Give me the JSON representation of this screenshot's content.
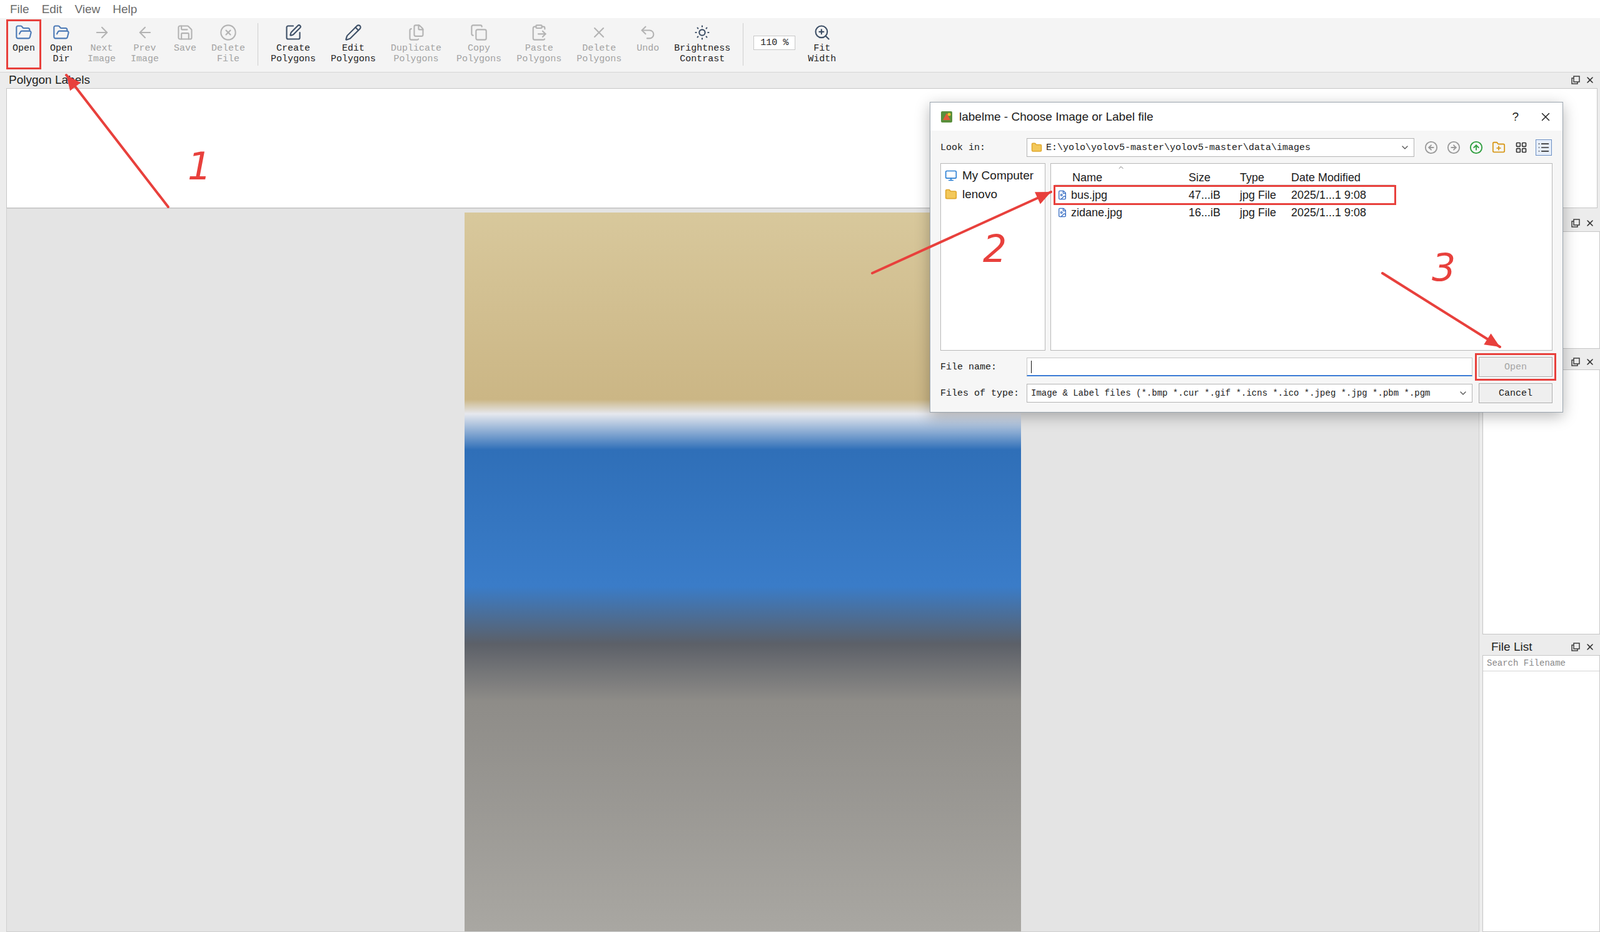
{
  "menu": [
    "File",
    "Edit",
    "View",
    "Help"
  ],
  "toolbar": [
    {
      "kind": "button",
      "label": "Open",
      "disabled": false,
      "highlighted": true
    },
    {
      "kind": "button",
      "label": "Open Dir",
      "disabled": false,
      "highlighted": false
    },
    {
      "kind": "button",
      "label": "Next Image",
      "disabled": true,
      "highlighted": false
    },
    {
      "kind": "button",
      "label": "Prev Image",
      "disabled": true,
      "highlighted": false
    },
    {
      "kind": "button",
      "label": "Save",
      "disabled": true,
      "highlighted": false
    },
    {
      "kind": "button",
      "label": "Delete File",
      "disabled": true,
      "highlighted": false
    },
    {
      "kind": "separator"
    },
    {
      "kind": "button",
      "label": "Create Polygons",
      "disabled": false,
      "highlighted": false
    },
    {
      "kind": "button",
      "label": "Edit Polygons",
      "disabled": false,
      "highlighted": false
    },
    {
      "kind": "button",
      "label": "Duplicate Polygons",
      "disabled": true,
      "highlighted": false
    },
    {
      "kind": "button",
      "label": "Copy Polygons",
      "disabled": true,
      "highlighted": false
    },
    {
      "kind": "button",
      "label": "Paste Polygons",
      "disabled": true,
      "highlighted": false
    },
    {
      "kind": "button",
      "label": "Delete Polygons",
      "disabled": true,
      "highlighted": false
    },
    {
      "kind": "button",
      "label": "Undo",
      "disabled": true,
      "highlighted": false
    },
    {
      "kind": "button",
      "label": "Brightness Contrast",
      "disabled": false,
      "highlighted": false
    },
    {
      "kind": "separator"
    },
    {
      "kind": "zoom",
      "label": "110 %"
    },
    {
      "kind": "button",
      "label": "Fit Width",
      "disabled": false,
      "highlighted": false
    }
  ],
  "docks": {
    "polygon_labels": {
      "title": "Polygon Labels"
    },
    "file_list": {
      "title": "File List",
      "search_placeholder": "Search Filename"
    }
  },
  "dialog": {
    "title": "labelme - Choose Image or Label file",
    "help": "?",
    "look_in_label": "Look in:",
    "path": "E:\\yolo\\yolov5-master\\yolov5-master\\data\\images",
    "places": [
      {
        "label": "My Computer",
        "selected": false
      },
      {
        "label": "lenovo",
        "selected": false
      }
    ],
    "columns": [
      "Name",
      "Size",
      "Type",
      "Date Modified"
    ],
    "files": [
      {
        "name": "bus.jpg",
        "size": "47...iB",
        "type": "jpg File",
        "date": "2025/1...1 9:08",
        "selected": false,
        "highlighted": true
      },
      {
        "name": "zidane.jpg",
        "size": "16...iB",
        "type": "jpg File",
        "date": "2025/1...1 9:08",
        "selected": false,
        "highlighted": false
      }
    ],
    "file_name_label": "File name:",
    "file_name_value": "",
    "types_label": "Files of type:",
    "types_value": "Image & Label files (*.bmp *.cur *.gif *.icns *.ico *.jpeg *.jpg *.pbm *.pgm",
    "buttons": [
      {
        "label": "Open",
        "disabled": true,
        "highlighted": true
      },
      {
        "label": "Cancel",
        "disabled": false,
        "highlighted": false
      }
    ]
  },
  "annotations": [
    {
      "label": "1"
    },
    {
      "label": "2"
    },
    {
      "label": "3"
    }
  ]
}
